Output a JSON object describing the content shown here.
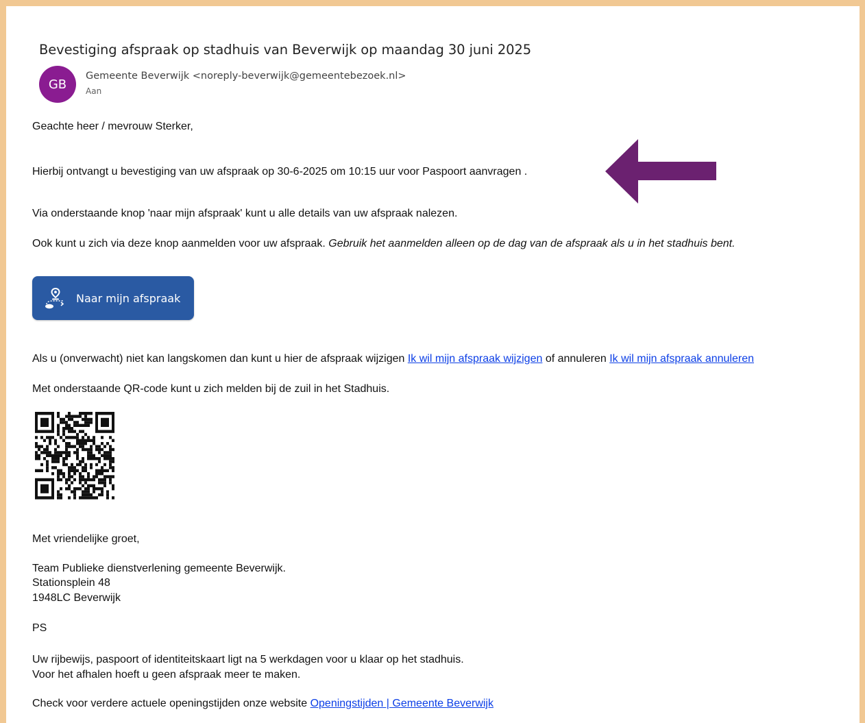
{
  "email": {
    "subject": "Bevestiging afspraak op stadhuis van Beverwijk op maandag 30 juni 2025",
    "avatar_initials": "GB",
    "avatar_color": "#8a1c91",
    "sender": "Gemeente Beverwijk <noreply-beverwijk@gemeentebezoek.nl>",
    "to_label": "Aan"
  },
  "body": {
    "greeting": "Geachte heer / mevrouw Sterker,",
    "confirmation": "Hierbij ontvangt u bevestiging van uw afspraak op 30-6-2025 om 10:15 uur voor Paspoort aanvragen .",
    "details_info": "Via onderstaande knop 'naar mijn afspraak' kunt u alle details van uw afspraak nalezen.",
    "checkin_text": "Ook kunt u zich via deze knop aanmelden voor uw afspraak. ",
    "checkin_italic": "Gebruik het aanmelden alleen op de dag van de afspraak als u in het stadhuis bent.",
    "button_label": "Naar mijn afspraak",
    "button_color": "#2a5aa3",
    "change_text": "Als u (onverwacht) niet kan langskomen dan kunt u hier de afspraak wijzigen ",
    "change_link": "Ik wil mijn afspraak wijzigen",
    "change_mid": " of annuleren ",
    "cancel_link": "Ik wil mijn afspraak annuleren",
    "qr_text": "Met onderstaande QR-code kunt u zich melden bij de zuil in het Stadhuis.",
    "closing": "Met vriendelijke groet,",
    "team": "Team Publieke dienstverlening gemeente Beverwijk.",
    "address1": "Stationsplein 48",
    "address2": "1948LC Beverwijk",
    "ps": "PS",
    "ps_line1": "Uw rijbewijs, paspoort of identiteitskaart ligt na 5 werkdagen voor u klaar op het stadhuis.",
    "ps_line2": "Voor het afhalen hoeft u geen afspraak meer te maken.",
    "website_text": "Check voor verdere actuele openingstijden onze website ",
    "website_link": "Openingstijden | Gemeente Beverwijk"
  },
  "annotation": {
    "arrow_color": "#6b2170",
    "frame_color": "#f1c893"
  },
  "icons": {
    "button_icon": "location-route-icon",
    "qr": "qr-code"
  }
}
